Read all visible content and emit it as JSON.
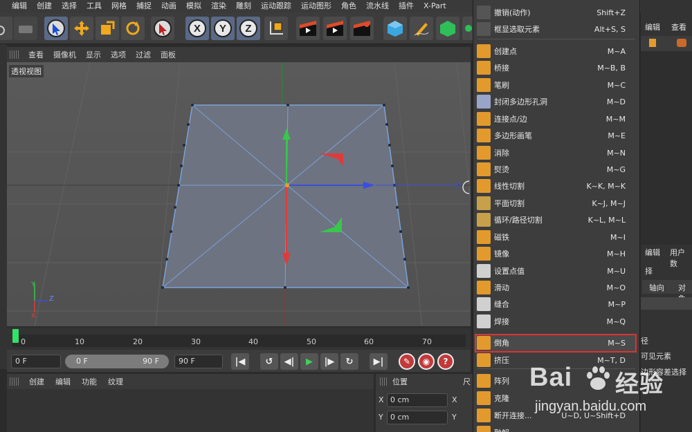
{
  "menubar": {
    "items": [
      "编辑",
      "创建",
      "选择",
      "工具",
      "网格",
      "捕捉",
      "动画",
      "模拟",
      "渲染",
      "雕刻",
      "运动跟踪",
      "运动图形",
      "角色",
      "流水线",
      "插件",
      "X-Part"
    ]
  },
  "toolbar": {
    "axis_x": "X",
    "axis_y": "Y",
    "axis_z": "Z"
  },
  "viewport_menu": {
    "items": [
      "查看",
      "摄像机",
      "显示",
      "选项",
      "过滤",
      "面板"
    ]
  },
  "viewport": {
    "label": "透视视图",
    "axis_labels": {
      "y": "Y",
      "z": "Z",
      "x": "X"
    }
  },
  "timeline": {
    "ticks": [
      "0",
      "10",
      "20",
      "30",
      "40",
      "50",
      "60",
      "70"
    ]
  },
  "transport": {
    "start_frame": "0 F",
    "range_start": "0 F",
    "range_end": "90 F",
    "end_frame": "90 F"
  },
  "material_menu": {
    "items": [
      "创建",
      "编辑",
      "功能",
      "纹理"
    ]
  },
  "coordinates": {
    "header": "位置",
    "header_right": "尺",
    "x_label": "X",
    "y_label": "Y",
    "x_value": "0 cm",
    "y_value": "0 cm",
    "x_label2": "X",
    "y_label2": "Y"
  },
  "context_menu": {
    "items": [
      {
        "label": "撤销(动作)",
        "shortcut": "Shift+Z"
      },
      {
        "label": "框显选取元素",
        "shortcut": "Alt+S, S"
      },
      {
        "label": "创建点",
        "shortcut": "M~A"
      },
      {
        "label": "桥接",
        "shortcut": "M~B, B"
      },
      {
        "label": "笔刷",
        "shortcut": "M~C"
      },
      {
        "label": "封闭多边形孔洞",
        "shortcut": "M~D"
      },
      {
        "label": "连接点/边",
        "shortcut": "M~M"
      },
      {
        "label": "多边形画笔",
        "shortcut": "M~E"
      },
      {
        "label": "消除",
        "shortcut": "M~N"
      },
      {
        "label": "熨烫",
        "shortcut": "M~G"
      },
      {
        "label": "线性切割",
        "shortcut": "K~K, M~K"
      },
      {
        "label": "平面切割",
        "shortcut": "K~J, M~J"
      },
      {
        "label": "循环/路径切割",
        "shortcut": "K~L, M~L"
      },
      {
        "label": "磁铁",
        "shortcut": "M~I"
      },
      {
        "label": "镜像",
        "shortcut": "M~H"
      },
      {
        "label": "设置点值",
        "shortcut": "M~U"
      },
      {
        "label": "滑动",
        "shortcut": "M~O"
      },
      {
        "label": "缝合",
        "shortcut": "M~P"
      },
      {
        "label": "焊接",
        "shortcut": "M~Q"
      },
      {
        "label": "倒角",
        "shortcut": "M~S"
      },
      {
        "label": "挤压",
        "shortcut": "M~T, D"
      },
      {
        "label": "阵列",
        "shortcut": ""
      },
      {
        "label": "克隆",
        "shortcut": ""
      },
      {
        "label": "断开连接...",
        "shortcut": "U~D, U~Shift+D"
      },
      {
        "label": "融解",
        "shortcut": ""
      }
    ]
  },
  "right_panel": {
    "tab_edit": "编辑",
    "tab_view": "查看",
    "tab_edit2": "编辑",
    "tab_user": "用户数",
    "select_text": "择",
    "col_axis": "轴向",
    "col_obj": "对象",
    "text_1": "径",
    "text_2": "可见元素",
    "text_3": "边形容差选择"
  },
  "watermark": {
    "brand": "Bai",
    "brand2": "经验",
    "url": "jingyan.baidu.com"
  },
  "colors": {
    "accent_highlight": "#d33333",
    "axis_x": "#e03a3a",
    "axis_y": "#39c64a",
    "axis_z": "#3a4ee0",
    "selected_edges": "#6f9bd8",
    "playhead": "#33e06a"
  }
}
